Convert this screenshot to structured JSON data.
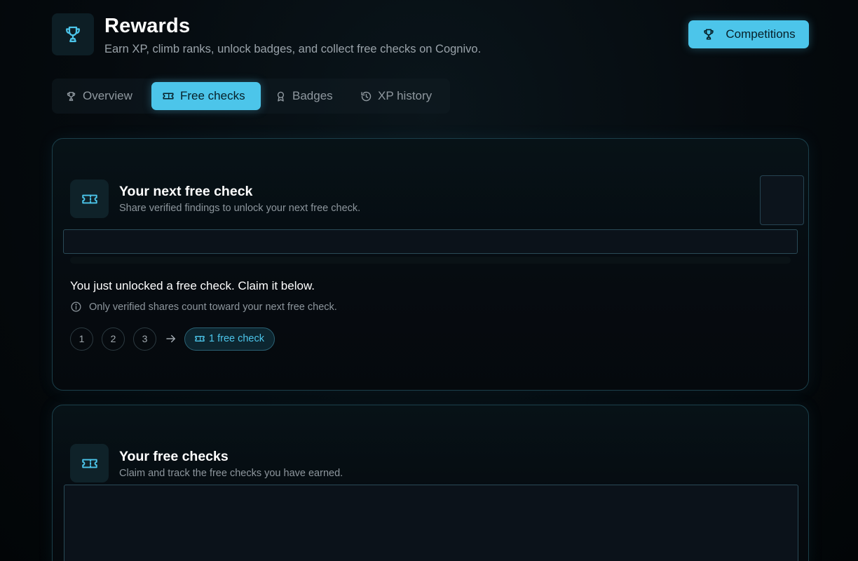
{
  "header": {
    "title": "Rewards",
    "subtitle": "Earn XP, climb ranks, unlock badges, and collect free checks on Cognivo.",
    "competitions_label": "Competitions"
  },
  "tabs": [
    {
      "label": "Overview",
      "icon": "trophy-icon"
    },
    {
      "label": "Free checks",
      "icon": "ticket-icon",
      "active": true
    },
    {
      "label": "Badges",
      "icon": "badge-icon"
    },
    {
      "label": "XP history",
      "icon": "history-icon"
    }
  ],
  "next_check": {
    "title": "Your next free check",
    "description": "Share verified findings to unlock your next free check.",
    "unlock_message": "You just unlocked a free check. Claim it below.",
    "info_text": "Only verified shares count toward your next free check.",
    "steps": [
      "1",
      "2",
      "3"
    ],
    "reward_label": "1 free check"
  },
  "free_checks": {
    "title": "Your free checks",
    "description": "Claim and track the free checks you have earned."
  },
  "colors": {
    "accent": "#4cc5ea",
    "background": "#03070a",
    "card_border": "#1b3f4a"
  }
}
